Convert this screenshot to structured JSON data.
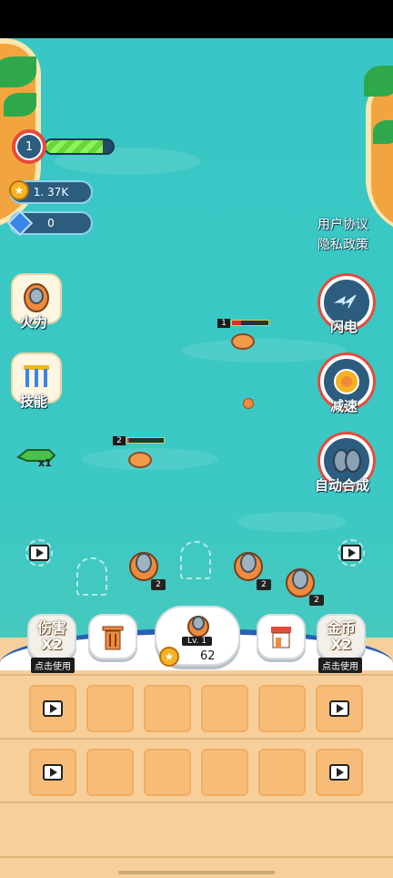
{
  "player": {
    "level": "1",
    "xp_fraction": 0.85,
    "coins": "1. 37K",
    "gems": "0"
  },
  "links": {
    "user_agreement": "用户协议",
    "privacy_policy": "隐私政策"
  },
  "left_buttons": {
    "firepower": "火力",
    "skill": "技能",
    "fish_bonus": "x1"
  },
  "right_buttons": {
    "lightning": "闪电",
    "slowdown": "减速",
    "auto_merge": "自动合成"
  },
  "enemies": [
    {
      "level": "1",
      "hp_fraction": 0.25
    },
    {
      "level": "2",
      "hp_fraction": 0.05
    }
  ],
  "cannons": [
    {
      "level": "2"
    },
    {
      "level": "2"
    },
    {
      "level": "2"
    }
  ],
  "bottom": {
    "damage_label": "伤害",
    "damage_mult": "X2",
    "damage_use": "点击使用",
    "buy_level": "Lv. 1",
    "buy_cost": "62",
    "gold_label": "金币",
    "gold_mult": "X2",
    "gold_use": "点击使用"
  },
  "colors": {
    "sea": "#38c7c6",
    "deck": "#f6cf9b",
    "accent_red": "#e74a3b",
    "ui_blue": "#2c5d7f"
  }
}
